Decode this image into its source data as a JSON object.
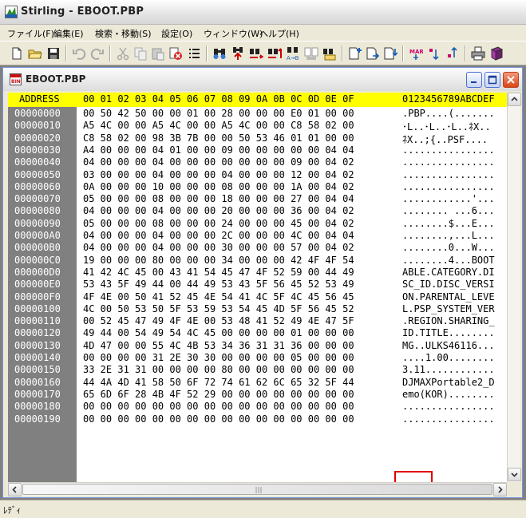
{
  "app": {
    "title": "Stirling - EBOOT.PBP"
  },
  "menu": {
    "items": [
      "ファイル(F)",
      "編集(E)",
      "検索・移動(S)",
      "設定(O)",
      "ウィンドウ(W)",
      "ヘルプ(H)"
    ]
  },
  "toolbar": {
    "buttons": [
      "new-file-icon",
      "open-folder-icon",
      "save-icon",
      "undo-icon",
      "redo-icon",
      "cut-icon",
      "copy-icon",
      "paste-icon",
      "delete-icon",
      "list-icon",
      "find-icon",
      "find-prev-icon",
      "find-next-icon",
      "find-all-icon",
      "replace-icon",
      "compare-icon",
      "jump-icon",
      "insert-icon",
      "insert-file-icon",
      "append-icon",
      "mark-icon",
      "next-mark-icon",
      "prev-mark-icon",
      "print-icon",
      "book-icon"
    ]
  },
  "document": {
    "title": "EBOOT.PBP",
    "header": {
      "address": "ADDRESS",
      "columns": "00 01 02 03 04 05 06 07 08 09 0A 0B 0C 0D 0E 0F",
      "ascii": "0123456789ABCDEF"
    },
    "rows": [
      {
        "addr": "00000000",
        "hex": "00 50 42 50 00 00 01 00 28 00 00 00 E0 01 00 00",
        "ascii": ".PBP....(......."
      },
      {
        "addr": "00000010",
        "hex": "A5 4C 00 00 A5 4C 00 00 A5 4C 00 00 C8 58 02 00",
        "ascii": "･L..･L..･L..ﾈX.."
      },
      {
        "addr": "00000020",
        "hex": "C8 58 02 00 98 3B 7B 00 00 50 53 46 01 01 00 00",
        "ascii": "ﾈX..;{..PSF...."
      },
      {
        "addr": "00000030",
        "hex": "A4 00 00 00 04 01 00 00 09 00 00 00 00 00 04 04",
        "ascii": "................"
      },
      {
        "addr": "00000040",
        "hex": "04 00 00 00 04 00 00 00 00 00 00 00 09 00 04 02",
        "ascii": "................"
      },
      {
        "addr": "00000050",
        "hex": "03 00 00 00 04 00 00 00 04 00 00 00 12 00 04 02",
        "ascii": "................"
      },
      {
        "addr": "00000060",
        "hex": "0A 00 00 00 10 00 00 00 08 00 00 00 1A 00 04 02",
        "ascii": "................"
      },
      {
        "addr": "00000070",
        "hex": "05 00 00 00 08 00 00 00 18 00 00 00 27 00 04 04",
        "ascii": "............'..."
      },
      {
        "addr": "00000080",
        "hex": "04 00 00 00 04 00 00 00 20 00 00 00 36 00 04 02",
        "ascii": "........ ...6..."
      },
      {
        "addr": "00000090",
        "hex": "05 00 00 00 08 00 00 00 24 00 00 00 45 00 04 02",
        "ascii": "........$...E..."
      },
      {
        "addr": "000000A0",
        "hex": "04 00 00 00 04 00 00 00 2C 00 00 00 4C 00 04 04",
        "ascii": "........,...L..."
      },
      {
        "addr": "000000B0",
        "hex": "04 00 00 00 04 00 00 00 30 00 00 00 57 00 04 02",
        "ascii": "........0...W..."
      },
      {
        "addr": "000000C0",
        "hex": "19 00 00 00 80 00 00 00 34 00 00 00 42 4F 4F 54",
        "ascii": "........4...BOOT"
      },
      {
        "addr": "000000D0",
        "hex": "41 42 4C 45 00 43 41 54 45 47 4F 52 59 00 44 49",
        "ascii": "ABLE.CATEGORY.DI"
      },
      {
        "addr": "000000E0",
        "hex": "53 43 5F 49 44 00 44 49 53 43 5F 56 45 52 53 49",
        "ascii": "SC_ID.DISC_VERSI"
      },
      {
        "addr": "000000F0",
        "hex": "4F 4E 00 50 41 52 45 4E 54 41 4C 5F 4C 45 56 45",
        "ascii": "ON.PARENTAL_LEVE"
      },
      {
        "addr": "00000100",
        "hex": "4C 00 50 53 50 5F 53 59 53 54 45 4D 5F 56 45 52",
        "ascii": "L.PSP_SYSTEM_VER"
      },
      {
        "addr": "00000110",
        "hex": "00 52 45 47 49 4F 4E 00 53 48 41 52 49 4E 47 5F",
        "ascii": ".REGION.SHARING_"
      },
      {
        "addr": "00000120",
        "hex": "49 44 00 54 49 54 4C 45 00 00 00 00 01 00 00 00",
        "ascii": "ID.TITLE........"
      },
      {
        "addr": "00000130",
        "hex": "4D 47 00 00 55 4C 4B 53 34 36 31 31 36 00 00 00",
        "ascii": "MG..ULKS46116..."
      },
      {
        "addr": "00000140",
        "hex": "00 00 00 00 31 2E 30 30 00 00 00 00 05 00 00 00",
        "ascii": "....1.00........"
      },
      {
        "addr": "00000150",
        "hex": "33 2E 31 31 00 00 00 00 80 00 00 00 00 00 00 00",
        "ascii": "3.11............"
      },
      {
        "addr": "00000160",
        "hex": "44 4A 4D 41 58 50 6F 72 74 61 62 6C 65 32 5F 44",
        "ascii": "DJMAXPortable2_D"
      },
      {
        "addr": "00000170",
        "hex": "65 6D 6F 28 4B 4F 52 29 00 00 00 00 00 00 00 00",
        "ascii": "emo(KOR)........"
      },
      {
        "addr": "00000180",
        "hex": "00 00 00 00 00 00 00 00 00 00 00 00 00 00 00 00",
        "ascii": "................"
      },
      {
        "addr": "00000190",
        "hex": "00 00 00 00 00 00 00 00 00 00 00 00 00 00 00 00",
        "ascii": "................"
      }
    ]
  },
  "status": {
    "text": "ﾚﾃﾞｨ"
  },
  "colors": {
    "header_bg": "#ffff00",
    "address_bg": "#808080",
    "highlight_box": "#e00000"
  }
}
